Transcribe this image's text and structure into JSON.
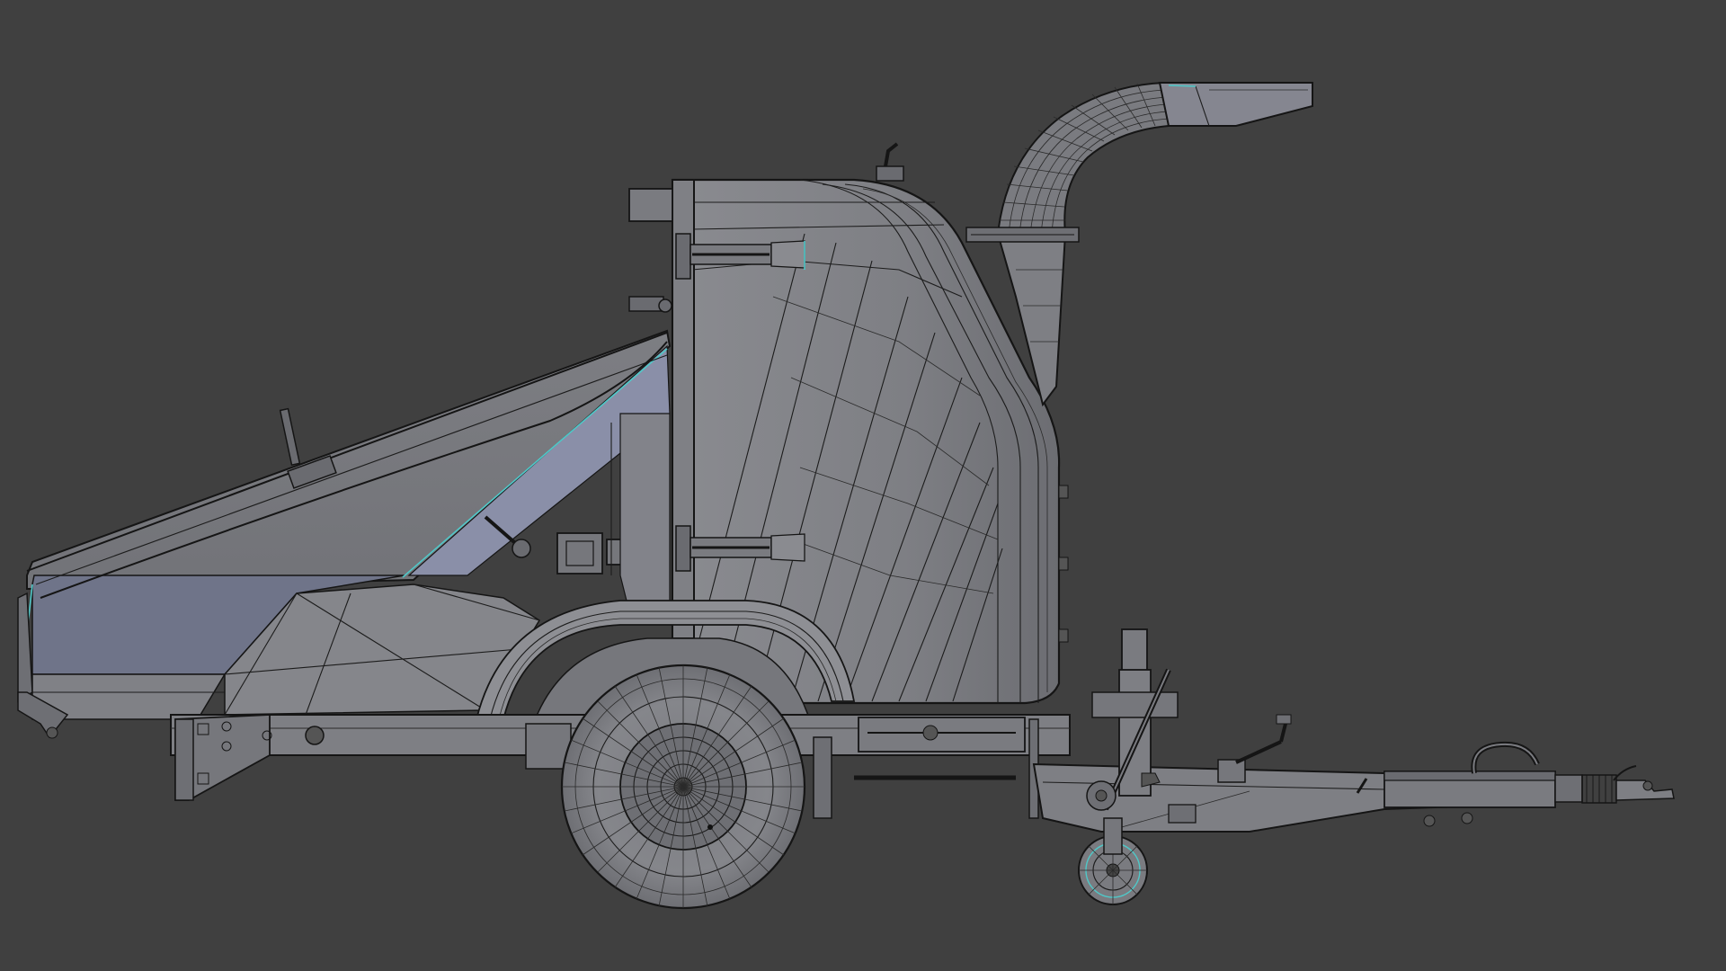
{
  "viewport": {
    "background_color": "#404040",
    "mesh_fill": "#7c7d82",
    "mesh_fill_light": "#8c8d92",
    "mesh_fill_dark": "#6a6b70",
    "hopper_inner_fill": "#6f7489",
    "wire_color": "#1c1c1c",
    "selection_color": "#4fc8c8"
  },
  "scene": {
    "object": "wood-chipper-trailer",
    "view": "side-orthographic",
    "display": "solid-wireframe-overlay",
    "parts": [
      "feed-hopper-icon",
      "chipper-body-icon",
      "discharge-chute-icon",
      "main-wheel-icon",
      "jockey-wheel-icon",
      "tow-bar-icon",
      "hitch-coupling-icon"
    ]
  }
}
